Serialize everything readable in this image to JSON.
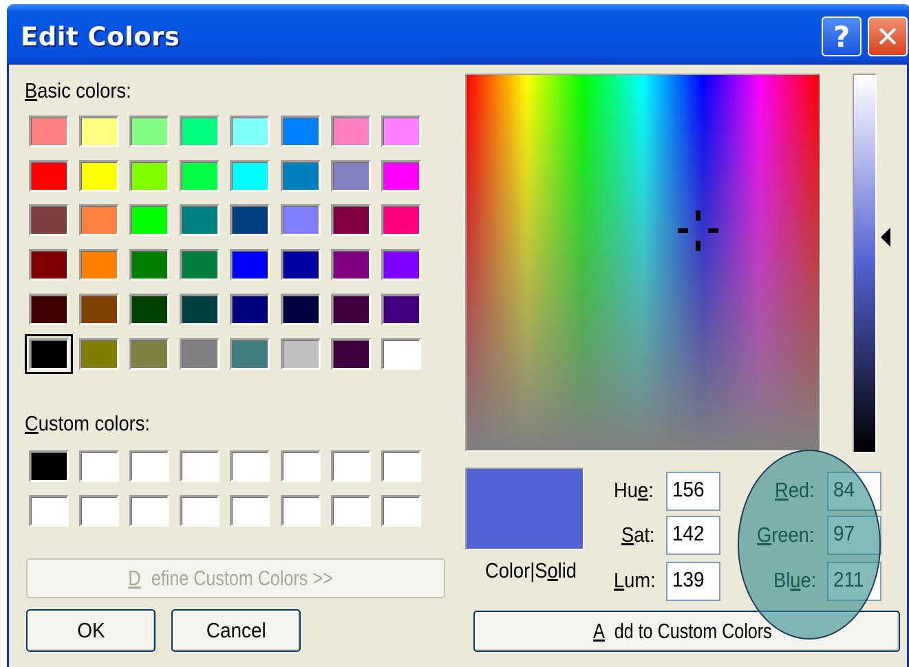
{
  "window": {
    "title": "Edit Colors",
    "help_glyph": "?",
    "close_glyph": "✕"
  },
  "basic_colors": {
    "label_prefix": "",
    "label_ul": "B",
    "label_rest": "asic colors:",
    "swatches": [
      "#ff8080",
      "#ffff80",
      "#80ff80",
      "#00ff80",
      "#80ffff",
      "#0080ff",
      "#ff80c0",
      "#ff80ff",
      "#ff0000",
      "#ffff00",
      "#80ff00",
      "#00ff40",
      "#00ffff",
      "#0080c0",
      "#8080c0",
      "#ff00ff",
      "#804040",
      "#ff8040",
      "#00ff00",
      "#008080",
      "#004080",
      "#8080ff",
      "#800040",
      "#ff0080",
      "#800000",
      "#ff8000",
      "#008000",
      "#008040",
      "#0000ff",
      "#0000a0",
      "#800080",
      "#8000ff",
      "#400000",
      "#804000",
      "#004000",
      "#004040",
      "#000080",
      "#000040",
      "#400040",
      "#400080",
      "#000000",
      "#808000",
      "#808040",
      "#808080",
      "#408080",
      "#c0c0c0",
      "#400040",
      "#ffffff"
    ],
    "selected_index": 40
  },
  "custom_colors": {
    "label_ul": "C",
    "label_rest": "ustom colors:",
    "swatches": [
      "#000000",
      "#ffffff",
      "#ffffff",
      "#ffffff",
      "#ffffff",
      "#ffffff",
      "#ffffff",
      "#ffffff",
      "#ffffff",
      "#ffffff",
      "#ffffff",
      "#ffffff",
      "#ffffff",
      "#ffffff",
      "#ffffff",
      "#ffffff"
    ]
  },
  "buttons": {
    "define_custom": {
      "ul": "D",
      "rest": "efine Custom Colors >>"
    },
    "ok": "OK",
    "cancel": "Cancel",
    "add_custom": {
      "ul": "A",
      "rest": "dd to Custom Colors"
    }
  },
  "preview": {
    "color": "#5462d3",
    "label_pre": "Color|S",
    "label_ul": "o",
    "label_post": "lid"
  },
  "hsl": {
    "hue": {
      "pre": "Hu",
      "ul": "e",
      "post": ":",
      "value": "156"
    },
    "sat": {
      "pre": "",
      "ul": "S",
      "post": "at:",
      "value": "142"
    },
    "lum": {
      "pre": "",
      "ul": "L",
      "post": "um:",
      "value": "139"
    }
  },
  "rgb": {
    "red": {
      "pre": "",
      "ul": "R",
      "post": "ed:",
      "value": "84"
    },
    "green": {
      "pre": "",
      "ul": "G",
      "post": "reen:",
      "value": "97"
    },
    "blue": {
      "pre": "Bl",
      "ul": "u",
      "post": "e:",
      "value": "211"
    }
  },
  "luminance_slider": {
    "level_fraction": 0.43
  }
}
